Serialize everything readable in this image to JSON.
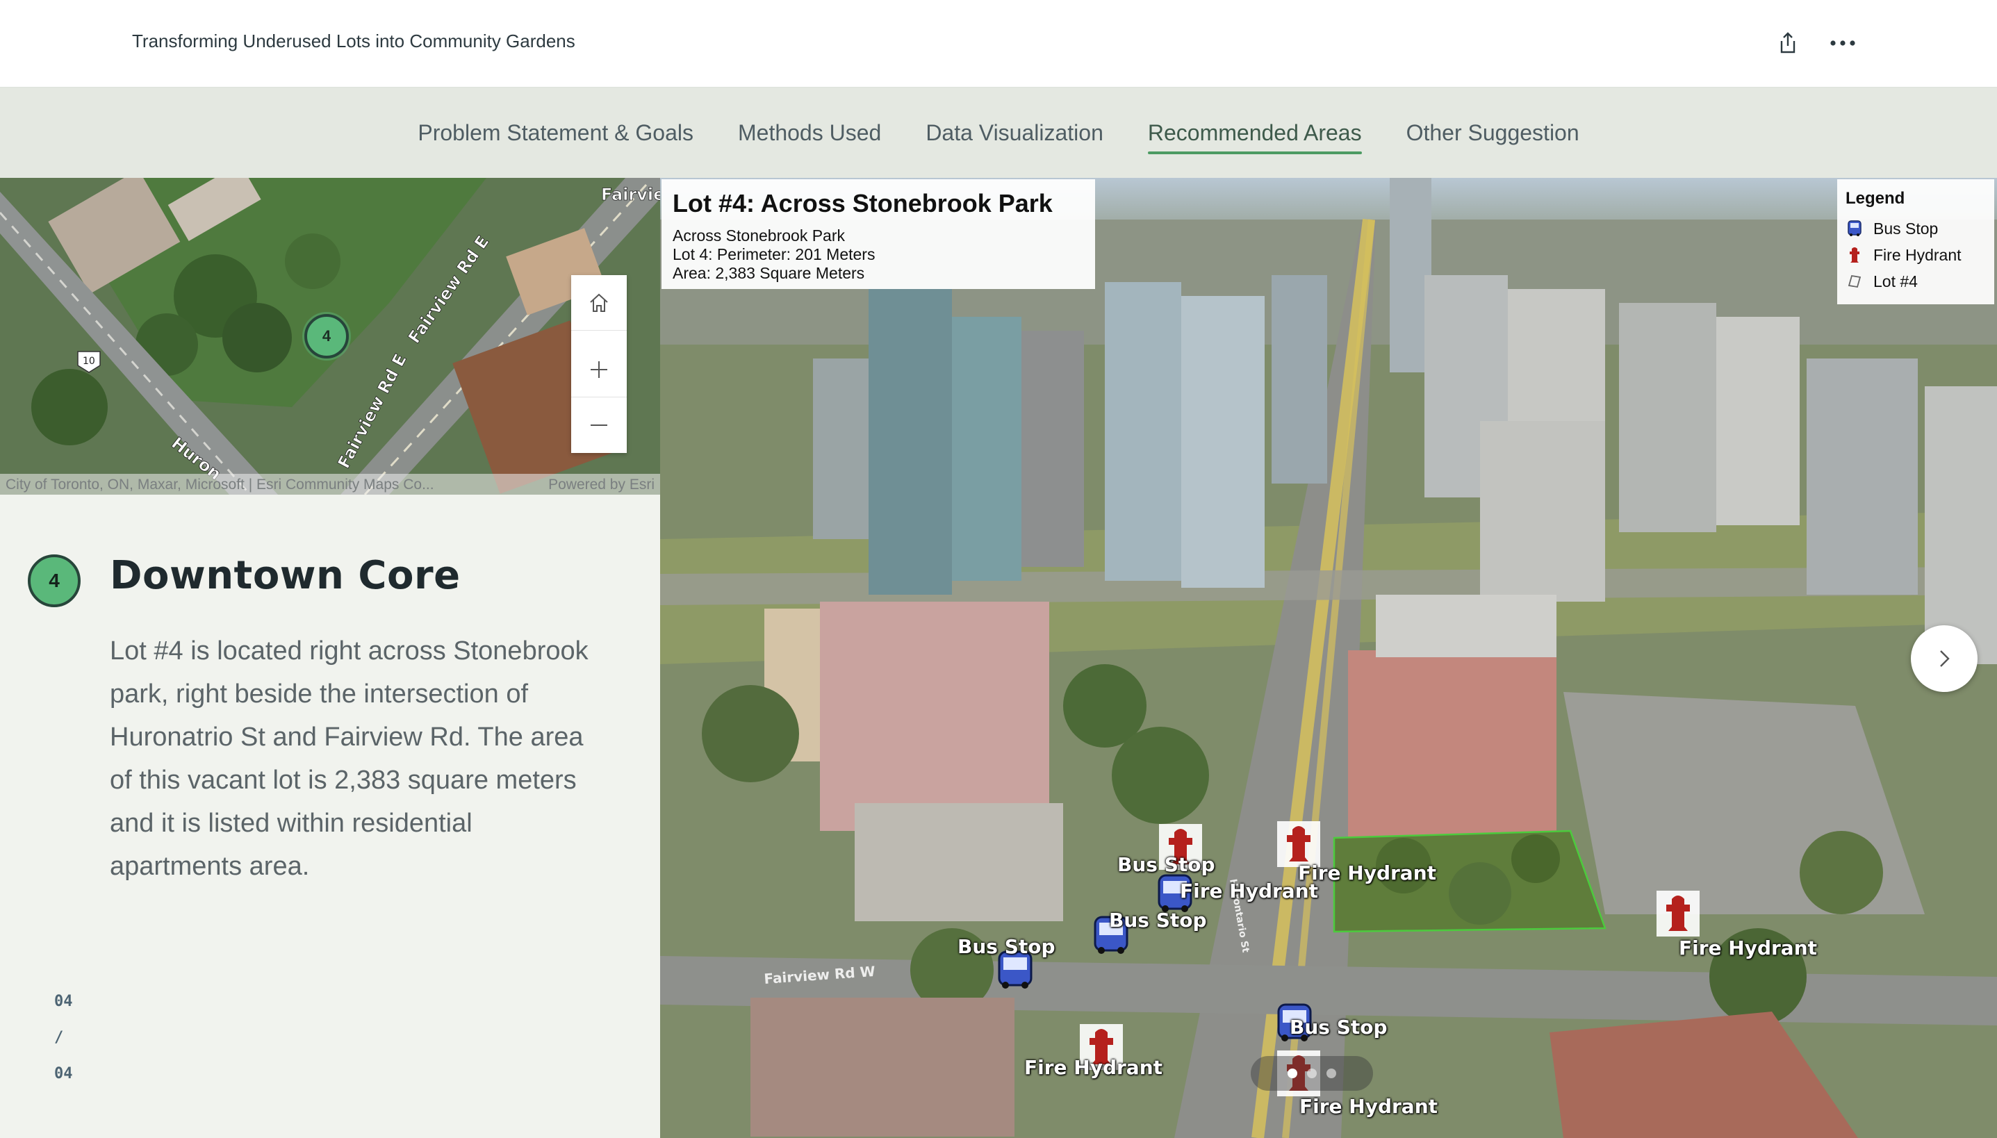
{
  "header": {
    "title": "Transforming Underused Lots into Community Gardens",
    "share_icon": "share-icon",
    "more_icon": "more-horizontal-icon"
  },
  "nav": {
    "tabs": [
      {
        "label": "Problem Statement & Goals",
        "active": false
      },
      {
        "label": "Methods Used",
        "active": false
      },
      {
        "label": "Data Visualization",
        "active": false
      },
      {
        "label": "Recommended Areas",
        "active": true
      },
      {
        "label": "Other Suggestion",
        "active": false
      }
    ]
  },
  "minimap": {
    "street_labels": [
      "Fairview",
      "Fairview Rd E",
      "Fairview Rd E",
      "Huron"
    ],
    "route_shield": "10",
    "lot_marker": "4",
    "attribution": "City of Toronto, ON, Maxar, Microsoft | Esri Community Maps Co...",
    "powered_by": "Powered by Esri",
    "controls": {
      "home": "home-icon",
      "zoom_in": "plus-icon",
      "zoom_out": "minus-icon"
    }
  },
  "section": {
    "number": "4",
    "title": "Downtown Core",
    "body": "Lot #4 is located right across Stonebrook park, right beside the intersection of Huronatrio St and Fairview Rd. The area of this vacant lot is 2,383 square meters and it is listed within residential apartments area."
  },
  "pager": {
    "current": "04",
    "sep": "/",
    "total": "04"
  },
  "scene": {
    "infobox": {
      "title": "Lot #4: Across Stonebrook Park",
      "lines": [
        "Across Stonebrook Park",
        "Lot 4: Perimeter: 201 Meters",
        "Area: 2,383 Square Meters"
      ]
    },
    "legend": {
      "title": "Legend",
      "items": [
        {
          "label": "Bus Stop",
          "icon": "bus-icon"
        },
        {
          "label": "Fire Hydrant",
          "icon": "hydrant-icon"
        },
        {
          "label": "Lot #4",
          "icon": "lot-outline-icon"
        }
      ]
    },
    "street_labels": [
      "Fairview Rd W",
      "Hurontario St"
    ],
    "markers": {
      "bus": "Bus Stop",
      "hydrant": "Fire Hydrant"
    },
    "next_icon": "chevron-right-icon",
    "carousel": {
      "count": 3,
      "active": 0
    }
  },
  "colors": {
    "accent": "#4d9b63",
    "badge_fill": "#5ab87a",
    "badge_border": "#27453a",
    "nav_bg": "#e4e8e1",
    "page_bg": "#f1f3ee"
  }
}
